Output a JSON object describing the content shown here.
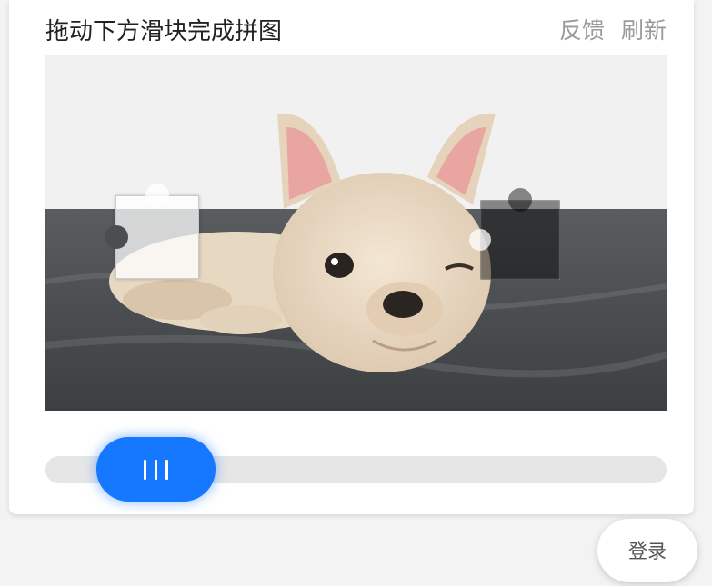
{
  "header": {
    "title": "拖动下方滑块完成拼图",
    "feedback_label": "反馈",
    "refresh_label": "刷新"
  },
  "puzzle": {
    "image_subject": "french-bulldog-puppy-photo"
  },
  "slider": {
    "handle_icon": "grip-lines-icon",
    "accent_color": "#1677ff",
    "track_color": "#e6e6e6"
  },
  "footer": {
    "login_label": "登录"
  }
}
